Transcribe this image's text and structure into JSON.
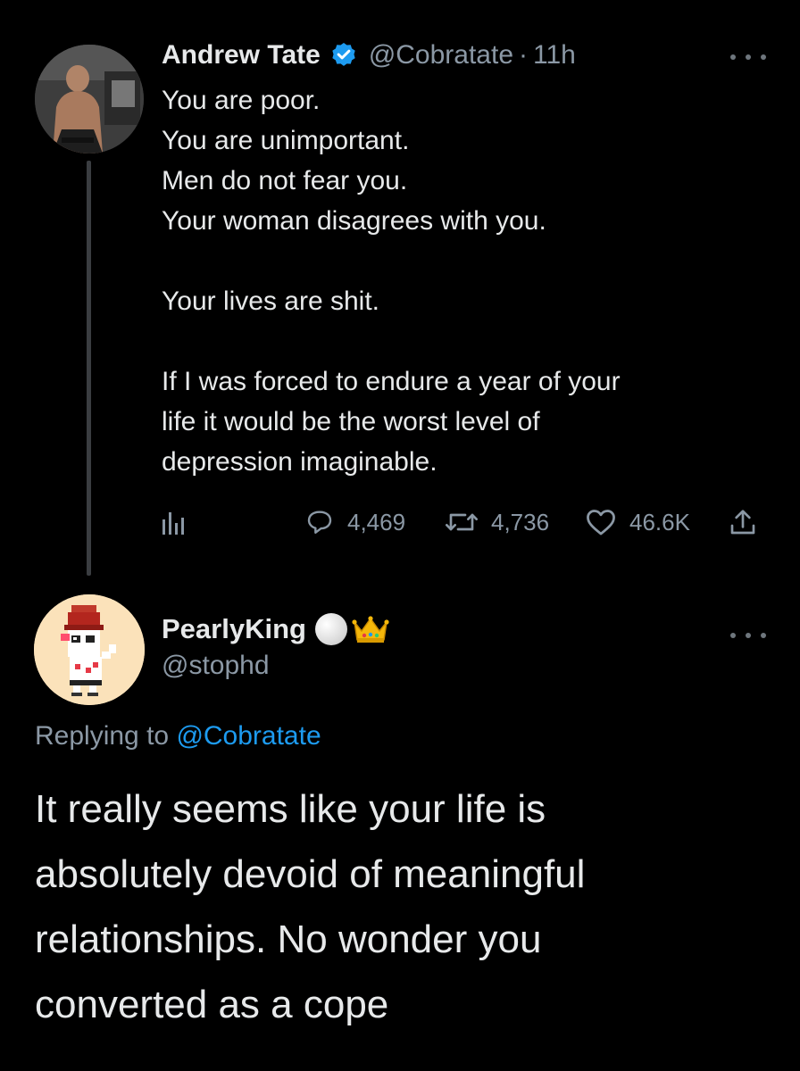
{
  "colors": {
    "background": "#000000",
    "text_primary": "#e7e9ea",
    "text_secondary": "#8b98a5",
    "link": "#1d9bf0",
    "verified_badge": "#1d9bf0"
  },
  "tweet": {
    "author": {
      "name": "Andrew Tate",
      "handle": "@Cobratate",
      "separator": "·",
      "time": "11h",
      "verified": true,
      "avatar_icon": "avatar-photo"
    },
    "lines": [
      "You are poor.",
      "You are unimportant.",
      "Men do not fear you.",
      "Your woman disagrees with you.",
      "",
      "Your lives are shit.",
      "",
      "If I was forced to endure a year of your",
      "life it would be the worst level of",
      "depression imaginable."
    ],
    "actions": {
      "analytics_icon": "analytics-icon",
      "replies": "4,469",
      "retweets": "4,736",
      "likes": "46.6K",
      "share_icon": "share-icon"
    }
  },
  "reply": {
    "author": {
      "name": "PearlyKing",
      "emojis": [
        "white-circle",
        "crown"
      ],
      "handle": "@stophd",
      "avatar_icon": "pixel-art-avatar"
    },
    "replying_prefix": "Replying to",
    "replying_to": "@Cobratate",
    "lines": [
      "It really seems like your life is",
      "absolutely devoid of meaningful",
      "relationships. No wonder you",
      "converted as a cope"
    ]
  }
}
